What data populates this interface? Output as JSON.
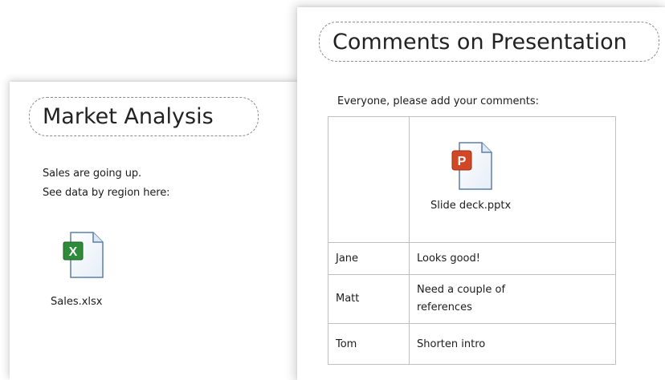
{
  "market_analysis": {
    "title": "Market Analysis",
    "text_line_1": "Sales are going up.",
    "text_line_2": "See data by region here:",
    "attachment": {
      "filename": "Sales.xlsx",
      "icon": "excel-file-icon",
      "color": "#2e8b3a"
    }
  },
  "comments_page": {
    "title": "Comments on Presentation",
    "instruction": "Everyone, please add your comments:",
    "attachment": {
      "filename": "Slide deck.pptx",
      "icon": "powerpoint-file-icon",
      "color": "#d24726"
    },
    "rows": [
      {
        "name": "Jane",
        "comment": "Looks good!"
      },
      {
        "name": "Matt",
        "comment": "Need a couple of references"
      },
      {
        "name": "Tom",
        "comment": "Shorten intro"
      }
    ]
  }
}
